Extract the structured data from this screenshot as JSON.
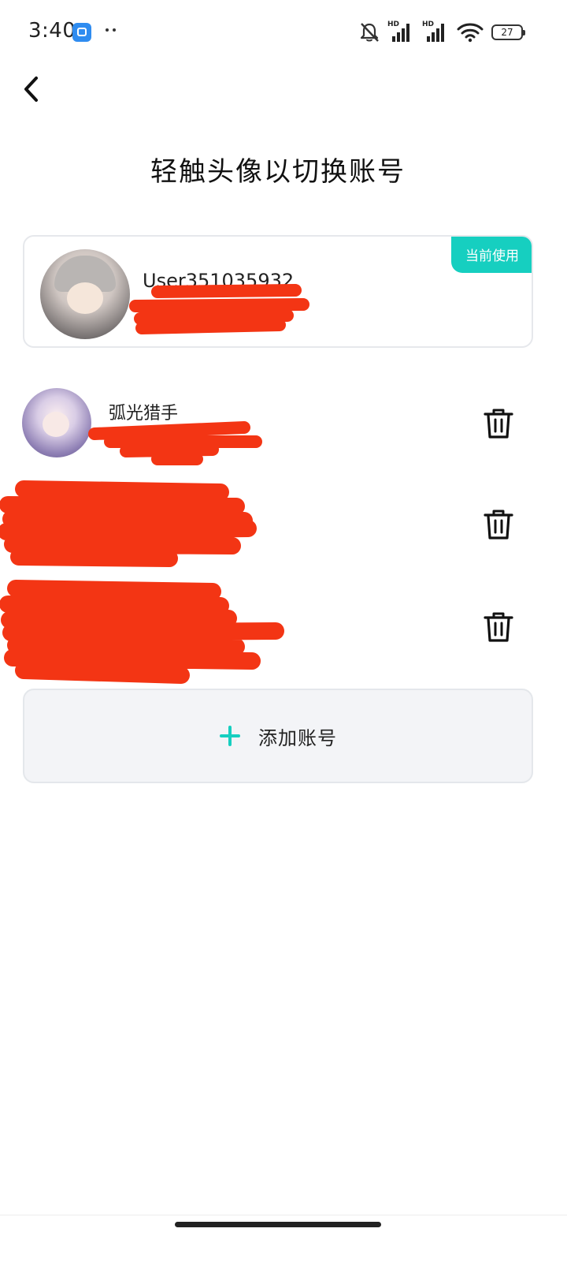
{
  "status_bar": {
    "time": "3:40",
    "network_label_1": "HD",
    "network_label_2": "HD",
    "battery_level": "27",
    "icons": [
      "app-notification-icon",
      "more-dots-icon",
      "silent-bell-icon",
      "signal-icon",
      "signal-icon",
      "wifi-icon",
      "battery-icon"
    ]
  },
  "header": {
    "back_icon": "chevron-left-icon",
    "title": "轻触头像以切换账号"
  },
  "current_account": {
    "badge": "当前使用",
    "name": "User351035932"
  },
  "accounts": [
    {
      "name": "弧光猎手",
      "delete_icon": "trash-icon"
    },
    {
      "name": "",
      "delete_icon": "trash-icon"
    },
    {
      "name": "",
      "delete_icon": "trash-icon"
    }
  ],
  "add_account": {
    "icon": "plus-icon",
    "label": "添加账号"
  },
  "colors": {
    "accent": "#16cfc0",
    "redaction": "#f33514",
    "card_border": "#e6e8ec",
    "button_bg": "#f3f4f7"
  }
}
